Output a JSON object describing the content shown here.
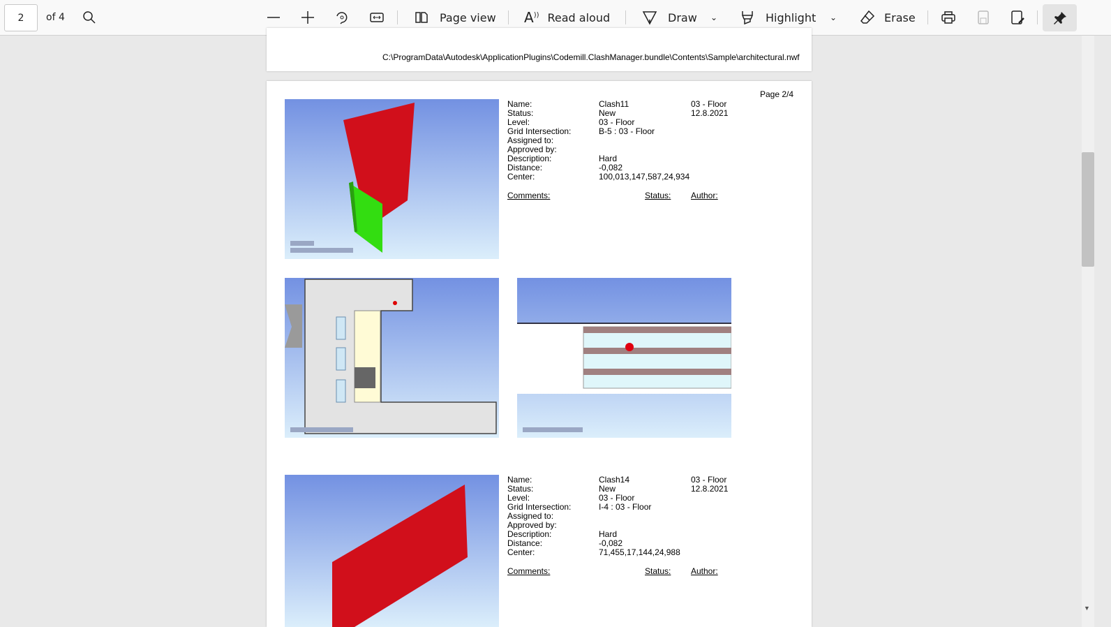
{
  "toolbar": {
    "page_number": "2",
    "page_count": "of 4",
    "page_view": "Page view",
    "read_aloud": "Read aloud",
    "draw": "Draw",
    "highlight": "Highlight",
    "erase": "Erase"
  },
  "document": {
    "file_path": "C:\\ProgramData\\Autodesk\\ApplicationPlugins\\Codemill.ClashManager.bundle\\Contents\\Sample\\architectural.nwf",
    "page_label": "Page 2/4",
    "labels": [
      "Name:",
      "Status:",
      "Level:",
      "Grid Intersection:",
      "Assigned to:",
      "Approved by:",
      "Description:",
      "Distance:",
      "Center:"
    ],
    "footer": {
      "comments": "Comments:",
      "status": "Status:",
      "author": "Author:"
    },
    "clashes": [
      {
        "values": [
          "Clash11",
          "New",
          "03 - Floor",
          "B-5 : 03 - Floor",
          "",
          "",
          "Hard",
          "-0,082",
          "100,013,147,587,24,934"
        ],
        "level": "03 - Floor",
        "date": "12.8.2021"
      },
      {
        "values": [
          "Clash14",
          "New",
          "03 - Floor",
          "I-4 : 03 - Floor",
          "",
          "",
          "Hard",
          "-0,082",
          "71,455,17,144,24,988"
        ],
        "level": "03 - Floor",
        "date": "12.8.2021"
      }
    ]
  }
}
